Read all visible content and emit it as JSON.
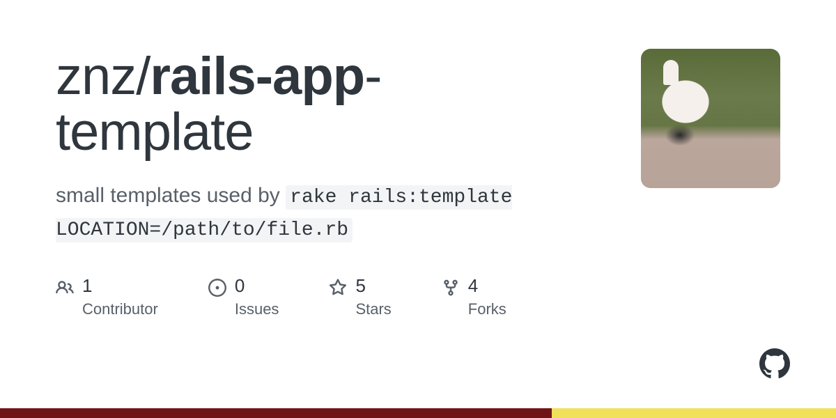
{
  "repo": {
    "owner": "znz",
    "name": "rails-app-template",
    "name_part1": "rails-app",
    "name_part2": "template"
  },
  "description": {
    "prefix": "small templates used by ",
    "code": "rake rails:template LOCATION=/path/to/file.rb"
  },
  "stats": {
    "contributors": {
      "count": "1",
      "label": "Contributor"
    },
    "issues": {
      "count": "0",
      "label": "Issues"
    },
    "stars": {
      "count": "5",
      "label": "Stars"
    },
    "forks": {
      "count": "4",
      "label": "Forks"
    }
  }
}
